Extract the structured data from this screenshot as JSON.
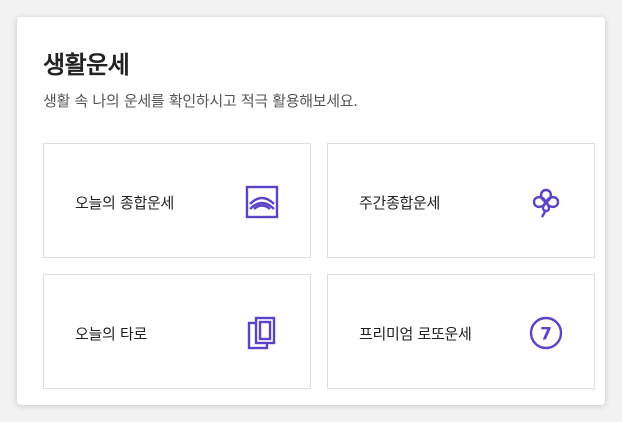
{
  "section": {
    "title": "생활운세",
    "subtitle": "생활 속 나의 운세를 확인하시고 적극 활용해보세요."
  },
  "items": [
    {
      "label": "오늘의 종합운세",
      "icon": "sunrise-frame-icon"
    },
    {
      "label": "주간종합운세",
      "icon": "clover-icon"
    },
    {
      "label": "오늘의 타로",
      "icon": "tarot-cards-icon"
    },
    {
      "label": "프리미엄 로또운세",
      "icon": "number-seven-icon",
      "icon_text": "7"
    }
  ],
  "colors": {
    "accent": "#5b43c9",
    "border": "#dedede",
    "text": "#222222",
    "subtext": "#555555"
  }
}
